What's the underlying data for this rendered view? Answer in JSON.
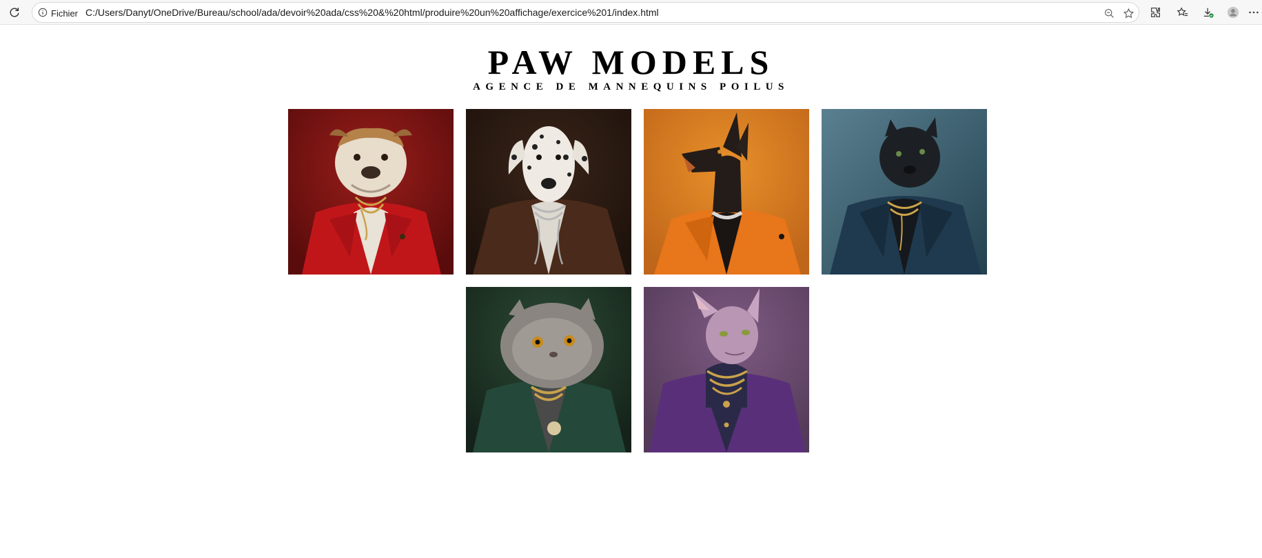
{
  "browser": {
    "site_label": "Fichier",
    "url": "C:/Users/Danyt/OneDrive/Bureau/school/ada/devoir%20ada/css%20&%20html/produire%20un%20affichage/exercice%201/index.html",
    "icons": [
      "refresh-icon",
      "info-icon",
      "zoom-out-icon",
      "star-icon",
      "extensions-icon",
      "favorites-icon",
      "downloads-icon",
      "profile-icon",
      "more-icon"
    ]
  },
  "header": {
    "title": "PAW MODELS",
    "subtitle": "AGENCE DE MANNEQUINS POILUS"
  },
  "models": [
    {
      "animal": "bulldog",
      "bg": "#7a1414",
      "coat": "#c0161a",
      "chain": "#c9a24a"
    },
    {
      "animal": "dalmatian",
      "bg": "#2b1a12",
      "coat": "#4a2a1a",
      "chain": "#b8b8b8"
    },
    {
      "animal": "doberman",
      "bg": "#d97a1c",
      "coat": "#e8761a",
      "chain": "#d0d0d0"
    },
    {
      "animal": "panther",
      "bg": "#3c6070",
      "coat": "#1f3a4f",
      "chain": "#c9a24a"
    },
    {
      "animal": "persian-cat",
      "bg": "#1e3325",
      "coat": "#24483a",
      "chain": "#c9a24a"
    },
    {
      "animal": "sphynx-cat",
      "bg": "#6a4a6e",
      "coat": "#5a2f7a",
      "chain": "#c9a24a"
    }
  ]
}
